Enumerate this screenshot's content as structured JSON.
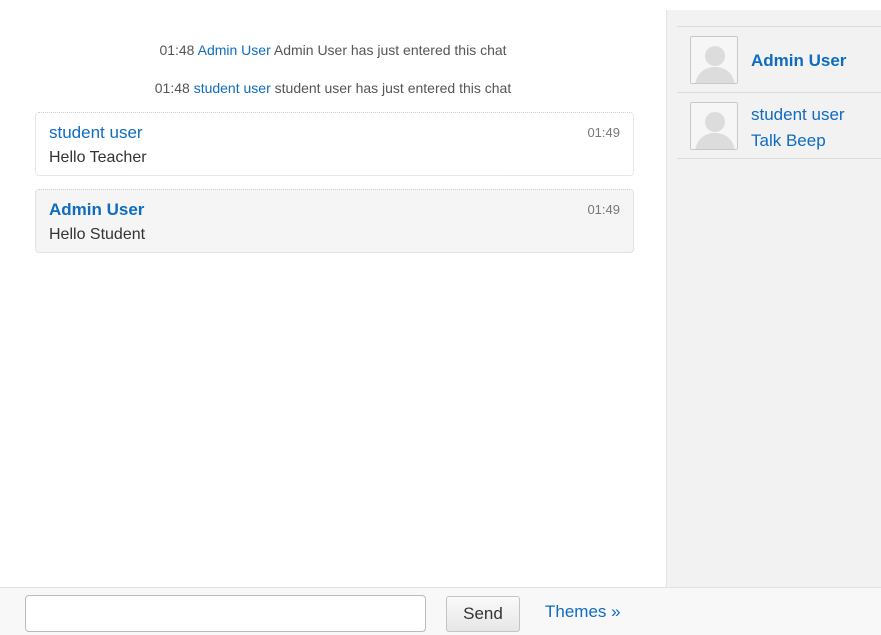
{
  "system_messages": [
    {
      "time": "01:48",
      "user": "Admin User",
      "text": "Admin User has just entered this chat"
    },
    {
      "time": "01:48",
      "user": "student user",
      "text": "student user has just entered this chat"
    }
  ],
  "messages": [
    {
      "author": "student user",
      "time": "01:49",
      "text": "Hello Teacher"
    },
    {
      "author": "Admin User",
      "time": "01:49",
      "text": "Hello Student"
    }
  ],
  "users": [
    {
      "name": "Admin User"
    },
    {
      "name": "student user",
      "action": "Talk Beep"
    }
  ],
  "input": {
    "value": "",
    "placeholder": ""
  },
  "send_label": "Send",
  "themes_label": "Themes »",
  "colors": {
    "link": "#0f6cbf",
    "panel_bg": "#f2f2f2"
  }
}
